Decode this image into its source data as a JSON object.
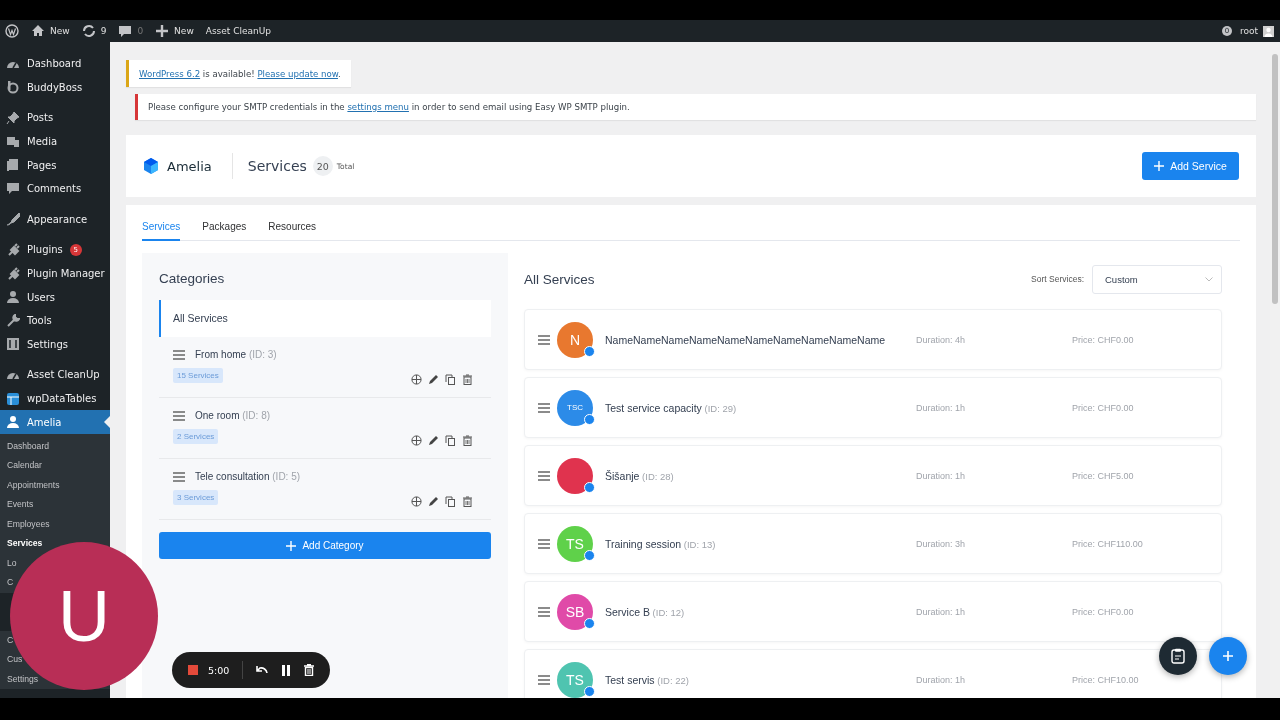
{
  "admin_bar": {
    "items": [
      {
        "kind": "logo"
      },
      {
        "kind": "home",
        "label": "New"
      },
      {
        "kind": "updates",
        "label": "9"
      },
      {
        "kind": "comments",
        "label": "0"
      },
      {
        "kind": "new",
        "label": "New"
      },
      {
        "kind": "text",
        "label": "Asset CleanUp"
      }
    ],
    "notifications": "0",
    "user": "root"
  },
  "sidebar": {
    "groups": [
      [
        {
          "label": "Dashboard",
          "current": false
        },
        {
          "label": "BuddyBoss",
          "current": false
        }
      ],
      [
        {
          "label": "Posts",
          "current": false
        },
        {
          "label": "Media",
          "current": false
        },
        {
          "label": "Pages",
          "current": false
        },
        {
          "label": "Comments",
          "current": false
        }
      ],
      [
        {
          "label": "Appearance",
          "current": false
        }
      ],
      [
        {
          "label": "Plugins",
          "current": false,
          "badge": "5"
        },
        {
          "label": "Plugin Manager",
          "current": false
        },
        {
          "label": "Users",
          "current": false
        },
        {
          "label": "Tools",
          "current": false
        },
        {
          "label": "Settings",
          "current": false
        }
      ],
      [
        {
          "label": "Asset CleanUp",
          "current": false
        },
        {
          "label": "wpDataTables",
          "current": false
        },
        {
          "label": "Amelia",
          "current": true
        }
      ]
    ],
    "submenu": [
      {
        "label": "Dashboard",
        "current": false
      },
      {
        "label": "Calendar",
        "current": false
      },
      {
        "label": "Appointments",
        "current": false
      },
      {
        "label": "Events",
        "current": false
      },
      {
        "label": "Employees",
        "current": false
      },
      {
        "label": "Services",
        "current": true
      },
      {
        "label": "Lo",
        "current": false
      },
      {
        "label": "C",
        "current": false
      }
    ],
    "submenu_lower": [
      {
        "label": "C",
        "current": false
      },
      {
        "label": "Cus",
        "current": false
      },
      {
        "label": "Settings",
        "current": false
      }
    ]
  },
  "notices": [
    {
      "kind": "warning",
      "parts": [
        {
          "kind": "link",
          "text": "WordPress 6.2"
        },
        {
          "kind": "text",
          "text": " is available! "
        },
        {
          "kind": "link",
          "text": "Please update now"
        },
        {
          "kind": "text",
          "text": "."
        }
      ]
    },
    {
      "kind": "error",
      "parts": [
        {
          "kind": "text",
          "text": "Please configure your SMTP credentials in the "
        },
        {
          "kind": "link",
          "text": "settings menu"
        },
        {
          "kind": "text",
          "text": " in order to send email using Easy WP SMTP plugin."
        }
      ]
    }
  ],
  "header": {
    "brand": "Amelia",
    "title": "Services",
    "count": "20",
    "count_label": "Total",
    "add_button": "Add Service"
  },
  "tabs": [
    {
      "label": "Services",
      "selected": true
    },
    {
      "label": "Packages",
      "selected": false
    },
    {
      "label": "Resources",
      "selected": false
    }
  ],
  "categories": {
    "title": "Categories",
    "all": {
      "label": "All Services",
      "selected": true
    },
    "items": [
      {
        "name": "From home",
        "id": "(ID: 3)",
        "count": "15 Services"
      },
      {
        "name": "One room",
        "id": "(ID: 8)",
        "count": "2 Services"
      },
      {
        "name": "Tele consultation",
        "id": "(ID: 5)",
        "count": "3 Services"
      }
    ],
    "add_button": "Add Category"
  },
  "services": {
    "title": "All Services",
    "sort_label": "Sort Services:",
    "sort_value": "Custom",
    "rows": [
      {
        "initials": "N",
        "color": "#e8782f",
        "name": "NameNameNameNameNameNameNameNameNameName",
        "duration": "Duration: 4h",
        "price": "Price: CHF0.00"
      },
      {
        "initials": "TSC",
        "color": "#2c8be8",
        "name": "Test service capacity",
        "id": "(ID: 29)",
        "duration": "Duration: 1h",
        "price": "Price: CHF0.00"
      },
      {
        "color": "#e0334e",
        "name": "Šišanje",
        "id": "(ID: 28)",
        "duration": "Duration: 1h",
        "price": "Price: CHF5.00"
      },
      {
        "initials": "TS",
        "color": "#5fd14a",
        "name": "Training session",
        "id": "(ID: 13)",
        "duration": "Duration: 3h",
        "price": "Price: CHF110.00"
      },
      {
        "initials": "SB",
        "color": "#e04aa8",
        "name": "Service B",
        "id": "(ID: 12)",
        "duration": "Duration: 1h",
        "price": "Price: CHF0.00"
      },
      {
        "initials": "TS",
        "color": "#4fc4b0",
        "name": "Test servis",
        "id": "(ID: 22)",
        "duration": "Duration: 1h",
        "price": "Price: CHF10.00"
      }
    ]
  },
  "camera_avatar": {
    "letter": "U"
  },
  "recorder": {
    "time": "5:00"
  }
}
